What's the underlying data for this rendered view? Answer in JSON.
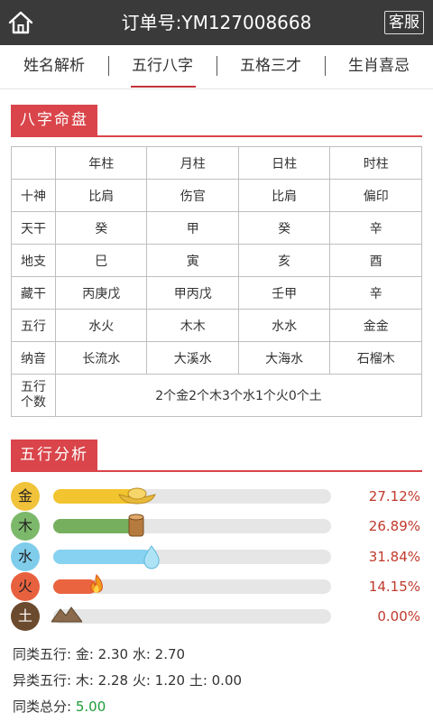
{
  "header": {
    "title": "订单号:YM127008668",
    "service_label": "客服"
  },
  "tabs": [
    {
      "label": "姓名解析"
    },
    {
      "label": "五行八字"
    },
    {
      "label": "五格三才"
    },
    {
      "label": "生肖喜忌"
    }
  ],
  "active_tab": 1,
  "bazi": {
    "section_title": "八字命盘",
    "columns": [
      "年柱",
      "月柱",
      "日柱",
      "时柱"
    ],
    "rows": [
      {
        "label": "十神",
        "cells": [
          "比肩",
          "伤官",
          "比肩",
          "偏印"
        ]
      },
      {
        "label": "天干",
        "cells": [
          "癸",
          "甲",
          "癸",
          "辛"
        ]
      },
      {
        "label": "地支",
        "cells": [
          "巳",
          "寅",
          "亥",
          "酉"
        ]
      },
      {
        "label": "藏干",
        "cells": [
          "丙庚戊",
          "甲丙戊",
          "壬甲",
          "辛"
        ]
      },
      {
        "label": "五行",
        "cells": [
          "水火",
          "木木",
          "水水",
          "金金"
        ]
      },
      {
        "label": "纳音",
        "cells": [
          "长流水",
          "大溪水",
          "大海水",
          "石榴木"
        ]
      }
    ],
    "count_label": "五行个数",
    "count_label_line1": "五行",
    "count_label_line2": "个数",
    "count_value": "2个金2个木3个水1个火0个土"
  },
  "wuxing": {
    "section_title": "五行分析",
    "items": [
      {
        "name": "金",
        "percent_text": "27.12%",
        "percent": 27.12,
        "circle_color": "#f1c33a",
        "fill_color": "#f2c42f",
        "icon": "gold-ingot-icon"
      },
      {
        "name": "木",
        "percent_text": "26.89%",
        "percent": 26.89,
        "circle_color": "#7cb86a",
        "fill_color": "#76b05f",
        "icon": "wood-log-icon"
      },
      {
        "name": "水",
        "percent_text": "31.84%",
        "percent": 31.84,
        "circle_color": "#7fcdeb",
        "fill_color": "#86d2f0",
        "icon": "water-drop-icon"
      },
      {
        "name": "火",
        "percent_text": "14.15%",
        "percent": 14.15,
        "circle_color": "#e8613f",
        "fill_color": "#ea6440",
        "icon": "fire-icon"
      },
      {
        "name": "土",
        "percent_text": "0.00%",
        "percent": 0,
        "circle_color": "#6b4a2e",
        "fill_color": "#8a6a4a",
        "icon": "mountain-icon"
      }
    ]
  },
  "stats": {
    "same_label": "同类五行:",
    "same_value": "金: 2.30 水: 2.70",
    "diff_label": "异类五行:",
    "diff_value": "木: 2.28 火: 1.20 土: 0.00",
    "total_label": "同类总分:",
    "total_value": "5.00"
  }
}
